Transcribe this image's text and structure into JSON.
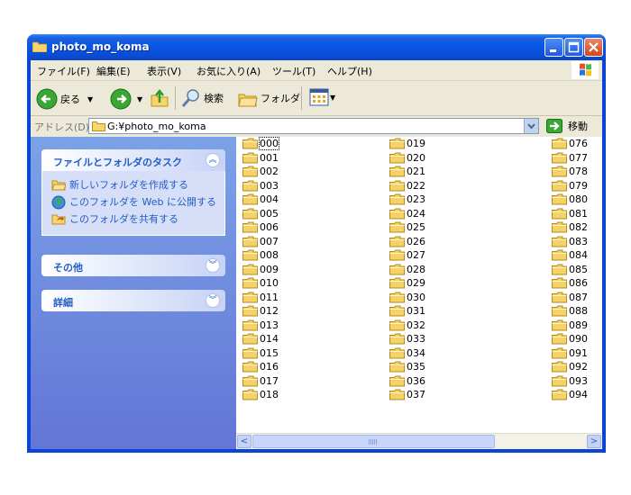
{
  "window": {
    "title": "photo_mo_koma"
  },
  "menu": {
    "items": [
      "ファイル(F)",
      "編集(E)",
      "表示(V)",
      "お気に入り(A)",
      "ツール(T)",
      "ヘルプ(H)"
    ]
  },
  "toolbar": {
    "back_label": "戻る",
    "search_label": "検索",
    "folders_label": "フォルダ"
  },
  "address": {
    "label": "アドレス(D)",
    "value": "G:¥photo_mo_koma",
    "go_label": "移動"
  },
  "taskpane": {
    "folder_tasks": {
      "title": "ファイルとフォルダのタスク",
      "items": [
        "新しいフォルダを作成する",
        "このフォルダを Web に公開する",
        "このフォルダを共有する"
      ]
    },
    "other": {
      "title": "その他"
    },
    "details": {
      "title": "詳細"
    }
  },
  "files": {
    "col1": [
      "000",
      "001",
      "002",
      "003",
      "004",
      "005",
      "006",
      "007",
      "008",
      "009",
      "010",
      "011",
      "012",
      "013",
      "014",
      "015",
      "016",
      "017",
      "018"
    ],
    "col2": [
      "019",
      "020",
      "021",
      "022",
      "023",
      "024",
      "025",
      "026",
      "027",
      "028",
      "029",
      "030",
      "031",
      "032",
      "033",
      "034",
      "035",
      "036",
      "037"
    ],
    "col3": [
      "076",
      "077",
      "078",
      "079",
      "080",
      "081",
      "082",
      "083",
      "084",
      "085",
      "086",
      "087",
      "088",
      "089",
      "090",
      "091",
      "092",
      "093",
      "094"
    ]
  },
  "colors": {
    "titlebar": "#0a4fd8",
    "taskpane": "#6f8fdf",
    "panel_title": "#215dc6",
    "folder": "#f5d167"
  }
}
